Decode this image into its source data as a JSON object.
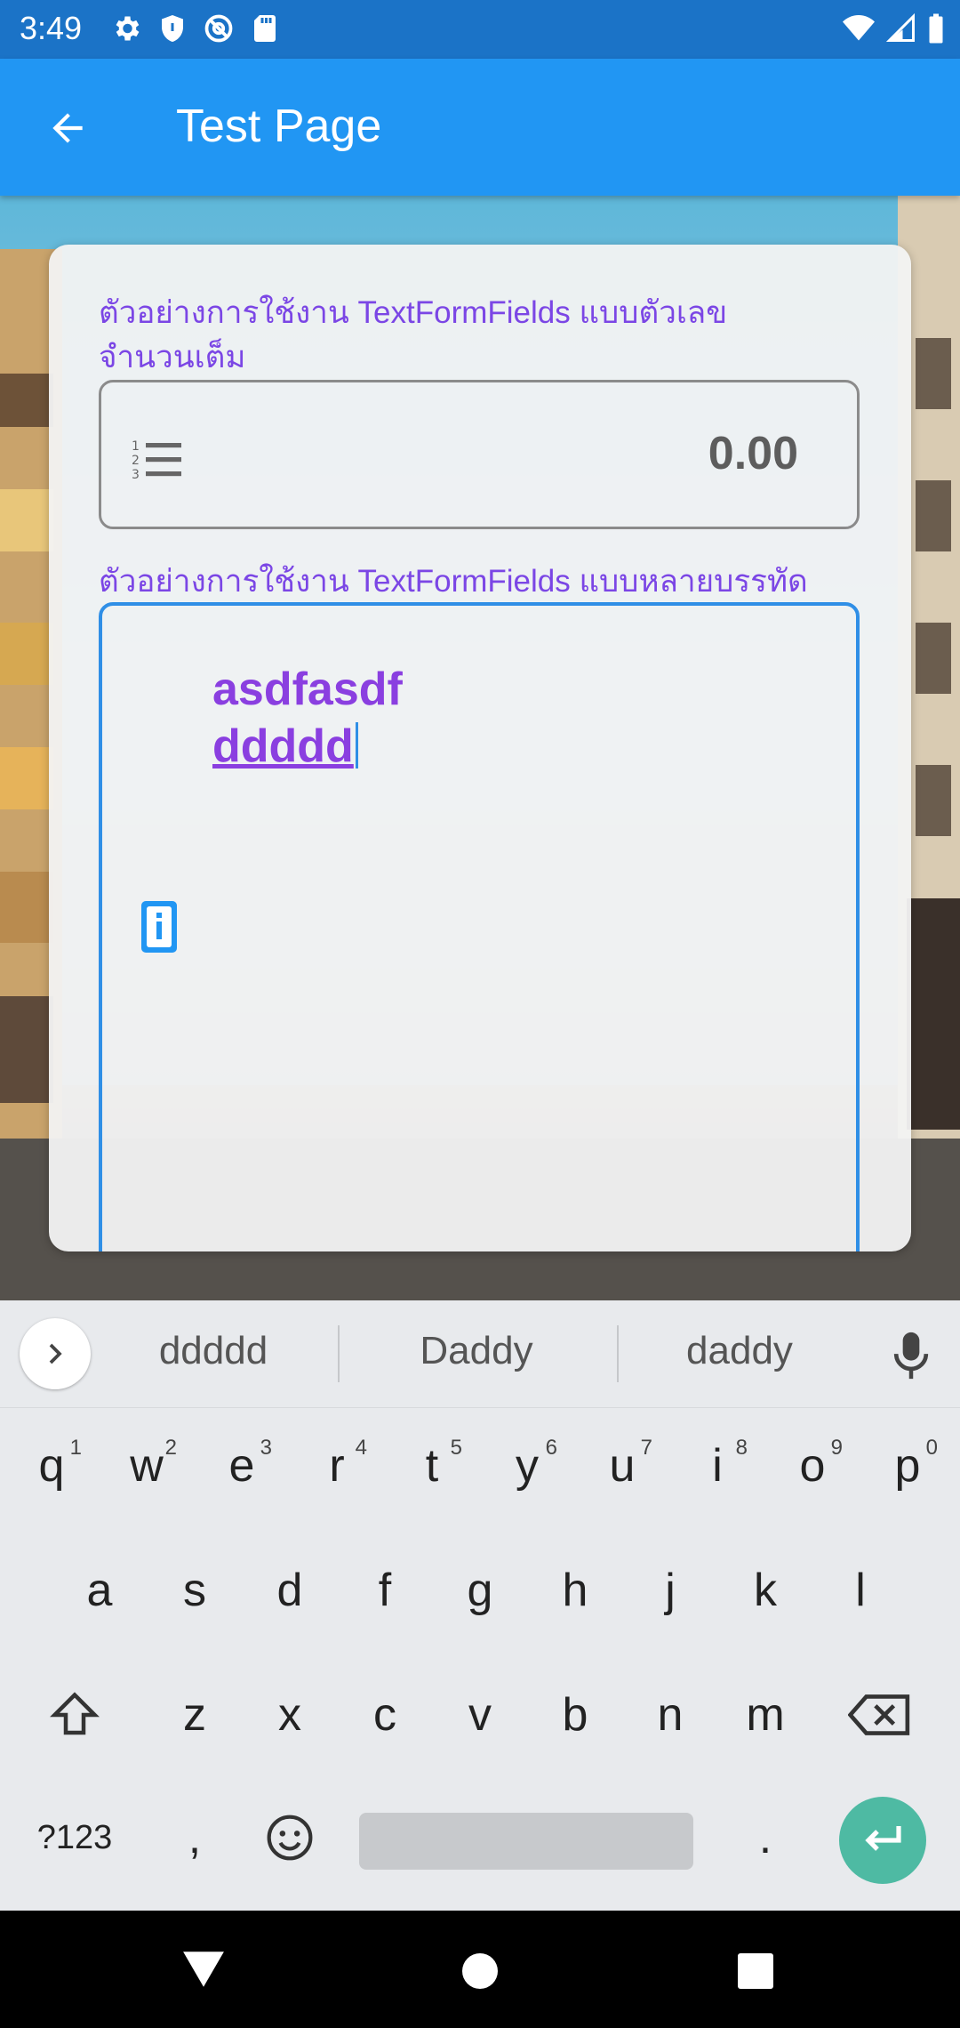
{
  "status_bar": {
    "time": "3:49",
    "left_icons": [
      "settings-icon",
      "shield-icon",
      "at-sign-icon",
      "sd-card-icon"
    ],
    "right_icons": [
      "wifi-icon",
      "signal-icon",
      "battery-icon"
    ]
  },
  "app_bar": {
    "back_icon": "arrow-left-icon",
    "title": "Test Page"
  },
  "form": {
    "number_field": {
      "label": "ตัวอย่างการใช้งาน TextFormFields แบบตัวเลขจำนวนเต็ม",
      "icon": "format-list-numbered-icon",
      "value": "0.00"
    },
    "multiline_field": {
      "label": "ตัวอย่างการใช้งาน TextFormFields แบบหลายบรรทัด",
      "line1": "asdfasdf",
      "line2": "ddddd",
      "icon": "info-icon"
    }
  },
  "keyboard": {
    "suggestions": [
      "ddddd",
      "Daddy",
      "daddy"
    ],
    "row1": [
      {
        "key": "q",
        "hint": "1"
      },
      {
        "key": "w",
        "hint": "2"
      },
      {
        "key": "e",
        "hint": "3"
      },
      {
        "key": "r",
        "hint": "4"
      },
      {
        "key": "t",
        "hint": "5"
      },
      {
        "key": "y",
        "hint": "6"
      },
      {
        "key": "u",
        "hint": "7"
      },
      {
        "key": "i",
        "hint": "8"
      },
      {
        "key": "o",
        "hint": "9"
      },
      {
        "key": "p",
        "hint": "0"
      }
    ],
    "row2": [
      "a",
      "s",
      "d",
      "f",
      "g",
      "h",
      "j",
      "k",
      "l"
    ],
    "row3": [
      "z",
      "x",
      "c",
      "v",
      "b",
      "n",
      "m"
    ],
    "symbols_key": "?123",
    "comma_key": ",",
    "period_key": ".",
    "enter_color": "#4ebaa3"
  },
  "colors": {
    "app_bar": "#2196f3",
    "status_bar": "#1b73c7",
    "label_text": "#7b46e5",
    "input_text": "#8a3fe0",
    "focus_border": "#2f8fe6"
  }
}
